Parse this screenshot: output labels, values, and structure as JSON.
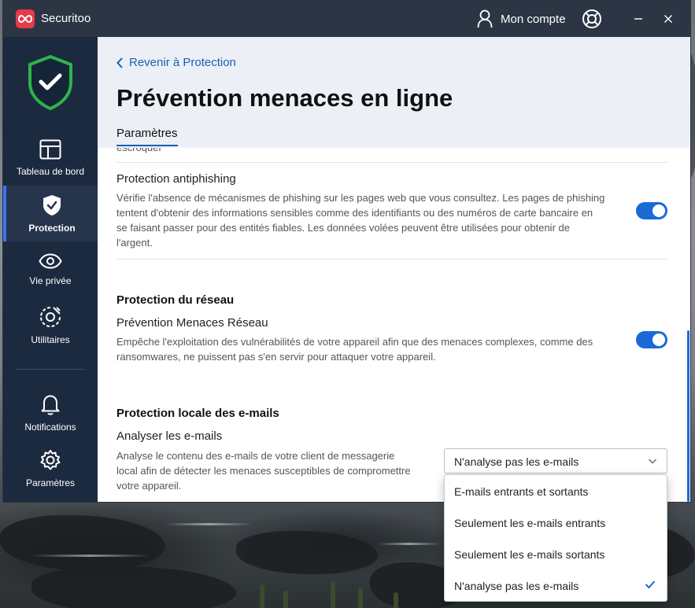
{
  "app": {
    "name": "Securitoo",
    "account_label": "Mon compte"
  },
  "sidebar": {
    "items": [
      {
        "label": "Tableau de bord"
      },
      {
        "label": "Protection"
      },
      {
        "label": "Vie privée"
      },
      {
        "label": "Utilitaires"
      },
      {
        "label": "Notifications"
      },
      {
        "label": "Paramètres"
      }
    ]
  },
  "header": {
    "back_label": "Revenir à Protection",
    "title": "Prévention menaces en ligne",
    "tab_label": "Paramètres"
  },
  "content": {
    "cut_text": "escroquer",
    "antiphishing": {
      "title": "Protection antiphishing",
      "description_lines": [
        "Vérifie l'absence de mécanismes de phishing sur les pages web que vous consultez. Les pages de phishing",
        "tentent d'obtenir des informations sensibles comme des identifiants ou des numéros de carte bancaire en",
        "se faisant passer pour des entités fiables. Les données volées peuvent être utilisées pour obtenir de",
        "l'argent."
      ],
      "enabled": true
    },
    "network": {
      "section_title": "Protection du réseau",
      "title": "Prévention Menaces Réseau",
      "description_lines": [
        "Empêche l'exploitation des vulnérabilités de votre appareil afin que des menaces complexes, comme des",
        "ransomwares, ne puissent pas s'en servir pour attaquer votre appareil."
      ],
      "enabled": true
    },
    "email": {
      "section_title": "Protection locale des e-mails",
      "title": "Analyser les e-mails",
      "description_lines": [
        "Analyse le contenu des e-mails de votre client de messagerie",
        "local afin de détecter les menaces susceptibles de compromettre",
        "votre appareil."
      ],
      "selected": "N'analyse pas les e-mails",
      "options": [
        "E-mails entrants et sortants",
        "Seulement les e-mails entrants",
        "Seulement les e-mails sortants",
        "N'analyse pas les e-mails"
      ]
    }
  },
  "colors": {
    "titlebar": "#2c3544",
    "sidebar": "#1c2a3f",
    "accent": "#1a6ad6",
    "shield_green": "#2db34a",
    "logo_red": "#e63b4c"
  },
  "icons": {
    "app_logo": "infinity-logo-icon",
    "account": "person-icon",
    "help": "lifebuoy-icon",
    "minimize": "minimize-icon",
    "close": "close-icon",
    "dashboard": "layout-icon",
    "protection": "shield-check-icon",
    "privacy": "eye-icon",
    "utilities": "gear-wrench-icon",
    "notifications": "bell-icon",
    "settings": "gear-icon",
    "status": "shield-check-icon",
    "dropdown": "chevron-down-icon",
    "selected": "checkmark-icon"
  }
}
